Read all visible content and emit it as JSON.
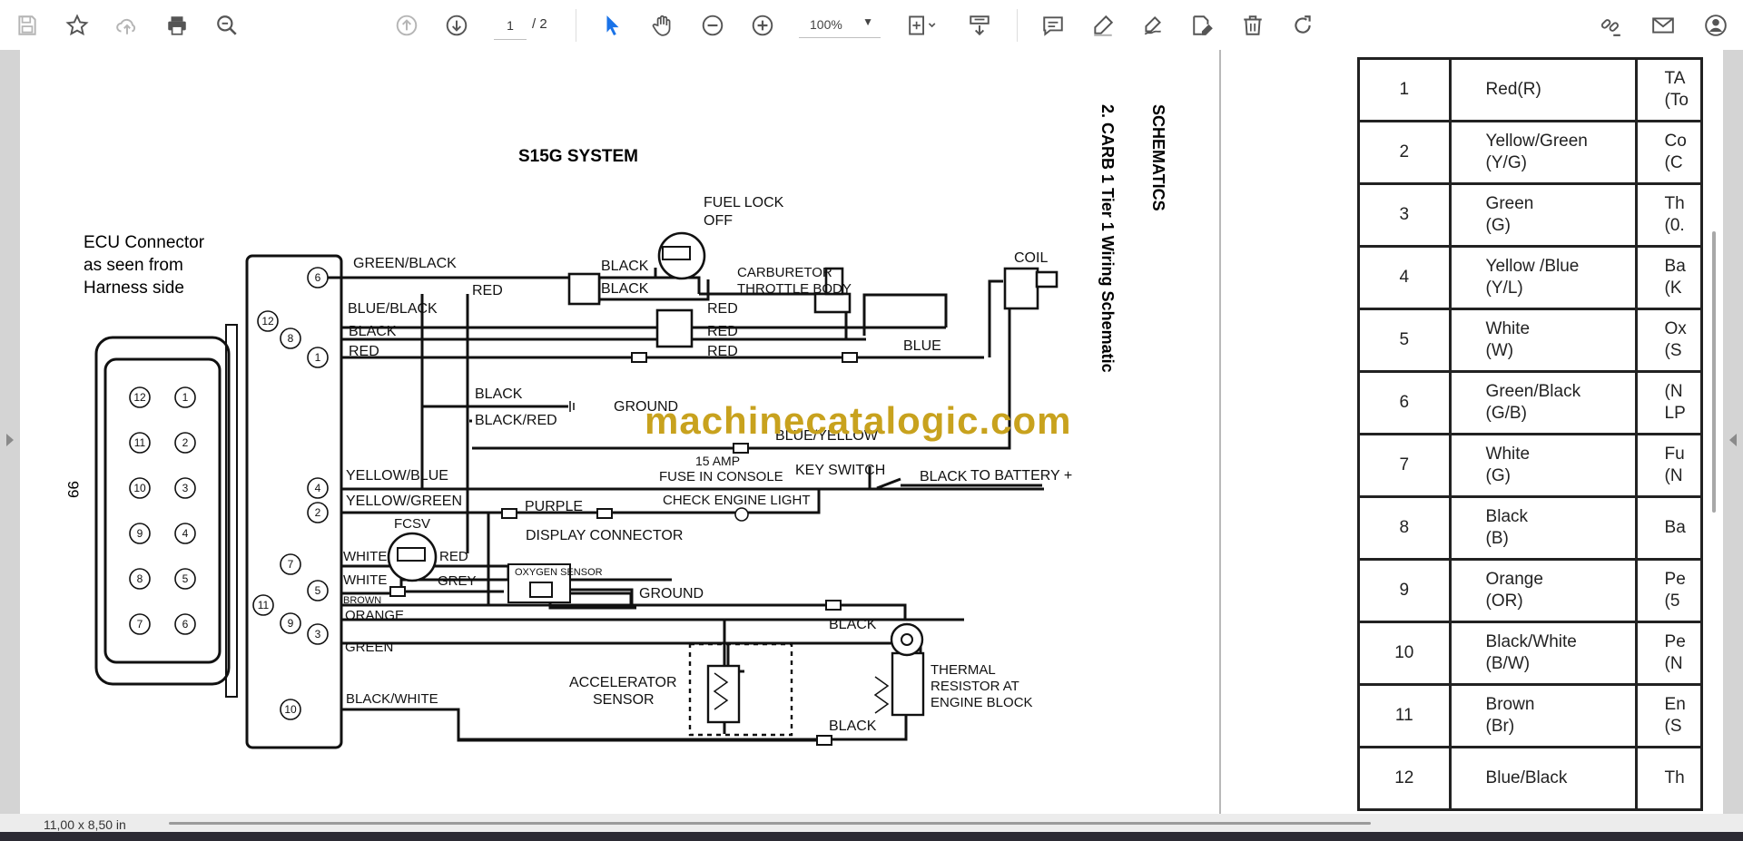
{
  "toolbar": {
    "current_page": "1",
    "page_total": "/ 2",
    "zoom": "100%"
  },
  "status": {
    "page_size": "11,00 x 8,50 in"
  },
  "page_number": "99",
  "watermark": "machinecatalogic.com",
  "schematic": {
    "title": "S15G SYSTEM",
    "side_heading": "SCHEMATICS",
    "side_title": "2. CARB 1 Tier 1 Wiring Schematic",
    "ecu_label": [
      "ECU Connector",
      "as seen from",
      "Harness side"
    ],
    "connector_pins_left": [
      "12",
      "11",
      "10",
      "9",
      "8",
      "7"
    ],
    "connector_pins_right": [
      "1",
      "2",
      "3",
      "4",
      "5",
      "6"
    ],
    "pins": {
      "p6": "6",
      "p12": "12",
      "p8": "8",
      "p1": "1",
      "p4": "4",
      "p2": "2",
      "p7": "7",
      "p5": "5",
      "p11": "11",
      "p9": "9",
      "p3": "3",
      "p10": "10"
    },
    "wires": {
      "green_black": "GREEN/BLACK",
      "blue_black": "BLUE/BLACK",
      "black": "BLACK",
      "red": "RED",
      "black_red": "BLACK/RED",
      "blue_yellow": "BLUE/YELLOW",
      "yellow_blue": "YELLOW/BLUE",
      "yellow_green": "YELLOW/GREEN",
      "purple": "PURPLE",
      "white": "WHITE",
      "grey": "GREY",
      "brown": "BROWN",
      "orange": "ORANGE",
      "green": "GREEN",
      "black_white": "BLACK/WHITE",
      "blue": "BLUE"
    },
    "components": {
      "fuel_lock": [
        "FUEL LOCK",
        "OFF"
      ],
      "carburetor": [
        "CARBURETOR",
        "THROTTLE BODY"
      ],
      "coil": "COIL",
      "ground": "GROUND",
      "fuse": [
        "15 AMP",
        "FUSE IN CONSOLE"
      ],
      "key_switch": "KEY SWITCH",
      "battery": "TO BATTERY +",
      "check_engine": "CHECK ENGINE LIGHT",
      "display_connector": "DISPLAY CONNECTOR",
      "fcsv": "FCSV",
      "oxygen_sensor": "OXYGEN SENSOR",
      "accelerator": [
        "ACCELERATOR",
        "SENSOR"
      ],
      "thermal": [
        "THERMAL",
        "RESISTOR AT",
        "ENGINE BLOCK"
      ]
    }
  },
  "color_table": [
    {
      "num": "1",
      "color": [
        "Red(R)"
      ],
      "desc": [
        "TA",
        "(To"
      ]
    },
    {
      "num": "2",
      "color": [
        "Yellow/Green",
        "(Y/G)"
      ],
      "desc": [
        "Co",
        "(C"
      ]
    },
    {
      "num": "3",
      "color": [
        "Green",
        "(G)"
      ],
      "desc": [
        "Th",
        "(0."
      ]
    },
    {
      "num": "4",
      "color": [
        "Yellow /Blue",
        "(Y/L)"
      ],
      "desc": [
        "Ba",
        "(K"
      ]
    },
    {
      "num": "5",
      "color": [
        "White",
        "(W)"
      ],
      "desc": [
        "Ox",
        "(S"
      ]
    },
    {
      "num": "6",
      "color": [
        "Green/Black",
        "(G/B)"
      ],
      "desc": [
        "(N",
        "LP"
      ]
    },
    {
      "num": "7",
      "color": [
        "White",
        "(G)"
      ],
      "desc": [
        "Fu",
        "(N"
      ]
    },
    {
      "num": "8",
      "color": [
        "Black",
        "(B)"
      ],
      "desc": [
        "Ba"
      ]
    },
    {
      "num": "9",
      "color": [
        "Orange",
        "(OR)"
      ],
      "desc": [
        "Pe",
        "(5"
      ]
    },
    {
      "num": "10",
      "color": [
        "Black/White",
        "(B/W)"
      ],
      "desc": [
        "Pe",
        "(N"
      ]
    },
    {
      "num": "11",
      "color": [
        "Brown",
        "(Br)"
      ],
      "desc": [
        "En",
        "(S"
      ]
    },
    {
      "num": "12",
      "color": [
        "Blue/Black"
      ],
      "desc": [
        "Th"
      ]
    }
  ]
}
